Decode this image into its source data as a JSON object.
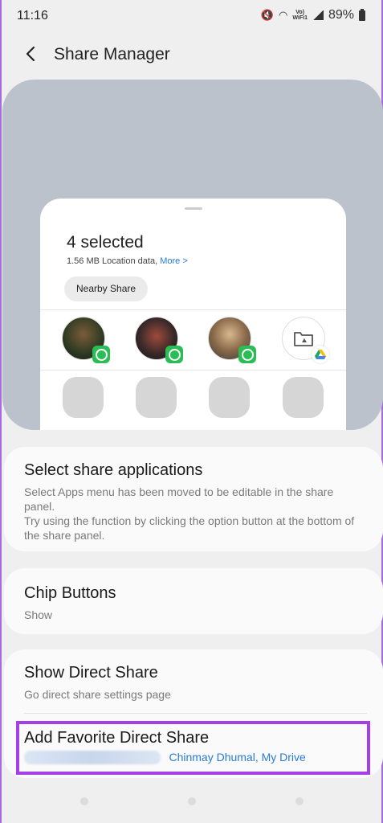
{
  "status_bar": {
    "time": "11:16",
    "battery": "89%",
    "volte_label": "Vo) LTE",
    "wifi_label": "WiFi1"
  },
  "header": {
    "title": "Share Manager"
  },
  "share_preview": {
    "selected_title": "4 selected",
    "size_text": "1.56 MB Location data,",
    "more_link": "More >",
    "chip_label": "Nearby Share"
  },
  "settings": {
    "select_apps": {
      "title": "Select share applications",
      "description": "Select Apps menu has been moved to be editable in the share panel.\nTry using the function by clicking the option button at the bottom of the share panel."
    },
    "chip_buttons": {
      "title": "Chip Buttons",
      "value": "Show"
    },
    "show_direct_share": {
      "title": "Show Direct Share",
      "description": "Go direct share settings page"
    },
    "add_favorite": {
      "title": "Add Favorite Direct Share",
      "value": "Chinmay Dhumal, My Drive"
    }
  },
  "colors": {
    "accent": "#2a7ad6",
    "highlight": "#a341e6",
    "whatsapp": "#2bbd55"
  }
}
